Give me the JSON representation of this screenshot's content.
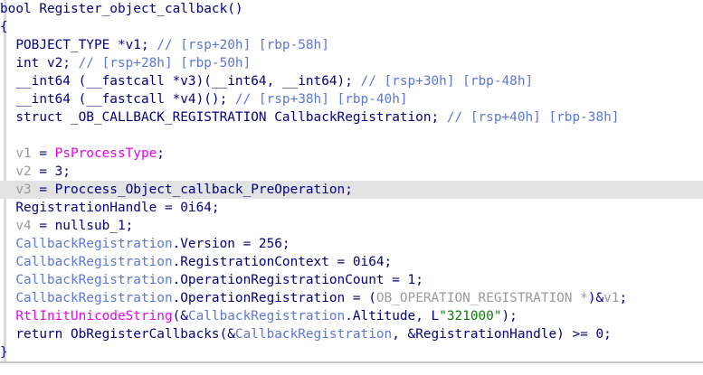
{
  "lines": [
    [
      {
        "t": "bool Register_object_callback()",
        "k": "k"
      }
    ],
    [
      {
        "t": "{",
        "k": "k"
      }
    ],
    [
      {
        "t": "  POBJECT_TYPE *v1; ",
        "k": "k"
      },
      {
        "t": "// [rsp+20h] [rbp-58h]",
        "k": "c"
      }
    ],
    [
      {
        "t": "  int v2; ",
        "k": "k"
      },
      {
        "t": "// [rsp+28h] [rbp-50h]",
        "k": "c"
      }
    ],
    [
      {
        "t": "  __int64 (__fastcall *v3)(__int64, __int64); ",
        "k": "k"
      },
      {
        "t": "// [rsp+30h] [rbp-48h]",
        "k": "c"
      }
    ],
    [
      {
        "t": "  __int64 (__fastcall *v4)(); ",
        "k": "k"
      },
      {
        "t": "// [rsp+38h] [rbp-40h]",
        "k": "c"
      }
    ],
    [
      {
        "t": "  struct _OB_CALLBACK_REGISTRATION CallbackRegistration; ",
        "k": "k"
      },
      {
        "t": "// [rsp+40h] [rbp-38h]",
        "k": "c"
      }
    ],
    [
      {
        "t": "",
        "k": "k"
      }
    ],
    [
      {
        "t": "  v1",
        "k": "g"
      },
      {
        "t": " = ",
        "k": "k"
      },
      {
        "t": "PsProcessType",
        "k": "m"
      },
      {
        "t": ";",
        "k": "k"
      }
    ],
    [
      {
        "t": "  v2",
        "k": "g"
      },
      {
        "t": " = 3;",
        "k": "k"
      }
    ],
    [
      {
        "t": "  v3",
        "k": "g"
      },
      {
        "t": " = Proccess_Object_callback_PreOperation;",
        "k": "k"
      }
    ],
    [
      {
        "t": "  RegistrationHandle = 0i64;",
        "k": "k"
      }
    ],
    [
      {
        "t": "  v4",
        "k": "g"
      },
      {
        "t": " = nullsub_1;",
        "k": "k"
      }
    ],
    [
      {
        "t": "  CallbackRegistration",
        "k": "f"
      },
      {
        "t": ".Version = 256;",
        "k": "k"
      }
    ],
    [
      {
        "t": "  CallbackRegistration",
        "k": "f"
      },
      {
        "t": ".RegistrationContext = 0i64;",
        "k": "k"
      }
    ],
    [
      {
        "t": "  CallbackRegistration",
        "k": "f"
      },
      {
        "t": ".OperationRegistrationCount = 1;",
        "k": "k"
      }
    ],
    [
      {
        "t": "  CallbackRegistration",
        "k": "f"
      },
      {
        "t": ".OperationRegistration = (",
        "k": "k"
      },
      {
        "t": "OB_OPERATION_REGISTRATION *",
        "k": "g"
      },
      {
        "t": ")&",
        "k": "k"
      },
      {
        "t": "v1",
        "k": "g"
      },
      {
        "t": ";",
        "k": "k"
      }
    ],
    [
      {
        "t": "  RtlInitUnicodeString",
        "k": "m"
      },
      {
        "t": "(&",
        "k": "k"
      },
      {
        "t": "CallbackRegistration",
        "k": "f"
      },
      {
        "t": ".Altitude, L",
        "k": "k"
      },
      {
        "t": "\"321000\"",
        "k": "s"
      },
      {
        "t": ");",
        "k": "k"
      }
    ],
    [
      {
        "t": "  return ObRegisterCallbacks(&",
        "k": "k"
      },
      {
        "t": "CallbackRegistration",
        "k": "f"
      },
      {
        "t": ", &RegistrationHandle) >= 0;",
        "k": "k"
      }
    ],
    [
      {
        "t": "}",
        "k": "k"
      }
    ]
  ],
  "highlighted_line": 10
}
